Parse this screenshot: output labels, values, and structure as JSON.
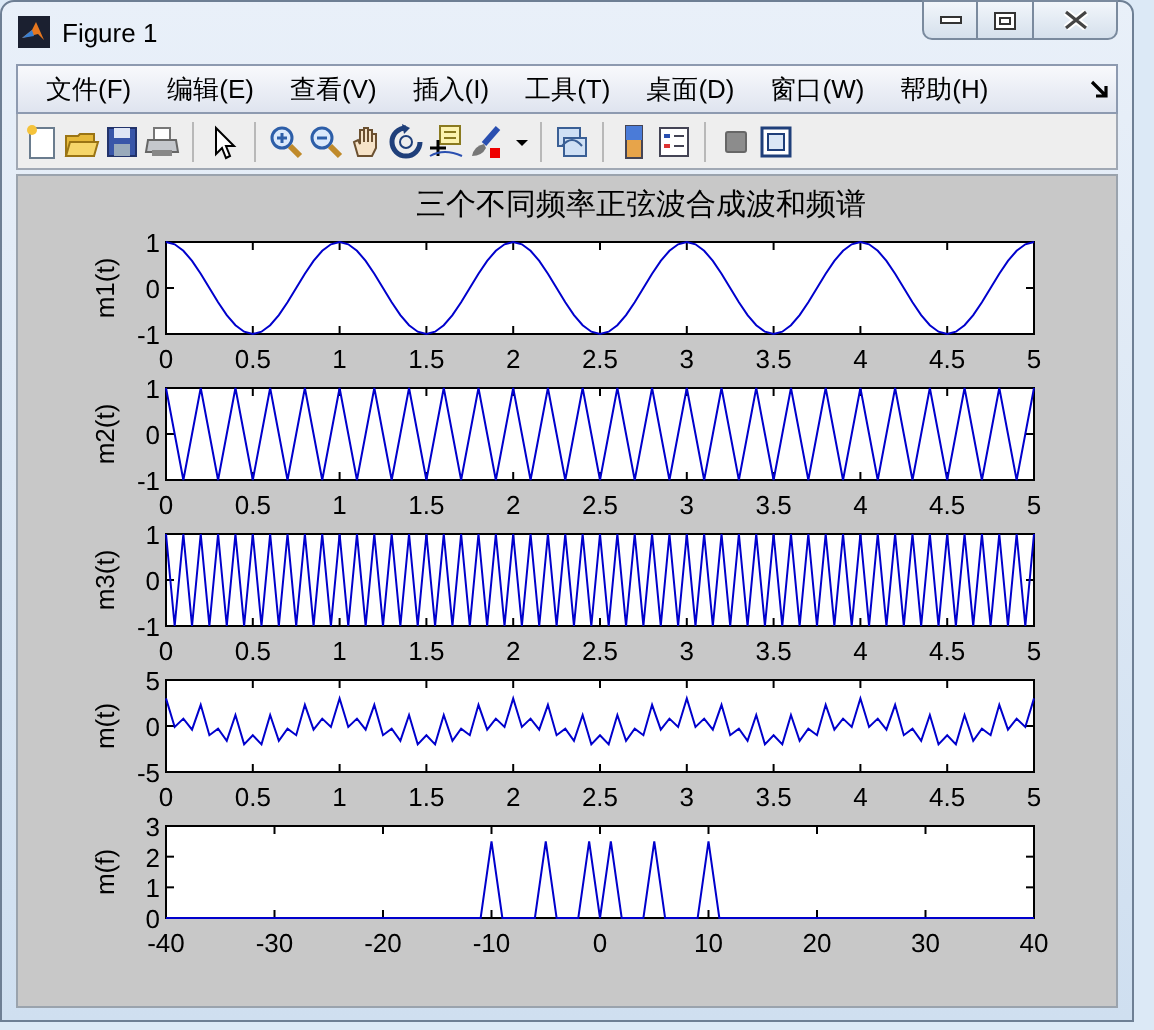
{
  "window": {
    "title": "Figure 1"
  },
  "menu": [
    "文件(F)",
    "编辑(E)",
    "查看(V)",
    "插入(I)",
    "工具(T)",
    "桌面(D)",
    "窗口(W)",
    "帮助(H)"
  ],
  "figure": {
    "title": "三个不同频率正弦波合成波和频谱",
    "axes": [
      {
        "chart_data": {
          "type": "line",
          "ylabel": "m1(t)",
          "xlim": [
            0,
            5
          ],
          "ylim": [
            -1,
            1
          ],
          "xticks": [
            0,
            0.5,
            1,
            1.5,
            2,
            2.5,
            3,
            3.5,
            4,
            4.5,
            5
          ],
          "yticks": [
            -1,
            0,
            1
          ],
          "x": [
            0,
            0.05,
            0.1,
            0.15,
            0.2,
            0.25,
            0.3,
            0.35,
            0.4,
            0.45,
            0.5,
            0.55,
            0.6,
            0.65,
            0.7,
            0.75,
            0.8,
            0.85,
            0.9,
            0.95,
            1,
            1.05,
            1.1,
            1.15,
            1.2,
            1.25,
            1.3,
            1.35,
            1.4,
            1.45,
            1.5,
            1.55,
            1.6,
            1.65,
            1.7,
            1.75,
            1.8,
            1.85,
            1.9,
            1.95,
            2,
            2.05,
            2.1,
            2.15,
            2.2,
            2.25,
            2.3,
            2.35,
            2.4,
            2.45,
            2.5,
            2.55,
            2.6,
            2.65,
            2.7,
            2.75,
            2.8,
            2.85,
            2.9,
            2.95,
            3,
            3.05,
            3.1,
            3.15,
            3.2,
            3.25,
            3.3,
            3.35,
            3.4,
            3.45,
            3.5,
            3.55,
            3.6,
            3.65,
            3.7,
            3.75,
            3.8,
            3.85,
            3.9,
            3.95,
            4,
            4.05,
            4.1,
            4.15,
            4.2,
            4.25,
            4.3,
            4.35,
            4.4,
            4.45,
            4.5,
            4.55,
            4.6,
            4.65,
            4.7,
            4.75,
            4.8,
            4.85,
            4.9,
            4.95,
            5
          ],
          "series": [
            {
              "color": "#0000cc",
              "values": [
                1,
                0.95,
                0.81,
                0.59,
                0.31,
                0,
                -0.31,
                -0.59,
                -0.81,
                -0.95,
                -1,
                -0.95,
                -0.81,
                -0.59,
                -0.31,
                0,
                0.31,
                0.59,
                0.81,
                0.95,
                1,
                0.95,
                0.81,
                0.59,
                0.31,
                0,
                -0.31,
                -0.59,
                -0.81,
                -0.95,
                -1,
                -0.95,
                -0.81,
                -0.59,
                -0.31,
                0,
                0.31,
                0.59,
                0.81,
                0.95,
                1,
                0.95,
                0.81,
                0.59,
                0.31,
                0,
                -0.31,
                -0.59,
                -0.81,
                -0.95,
                -1,
                -0.95,
                -0.81,
                -0.59,
                -0.31,
                0,
                0.31,
                0.59,
                0.81,
                0.95,
                1,
                0.95,
                0.81,
                0.59,
                0.31,
                0,
                -0.31,
                -0.59,
                -0.81,
                -0.95,
                -1,
                -0.95,
                -0.81,
                -0.59,
                -0.31,
                0,
                0.31,
                0.59,
                0.81,
                0.95,
                1,
                0.95,
                0.81,
                0.59,
                0.31,
                0,
                -0.31,
                -0.59,
                -0.81,
                -0.95,
                -1,
                -0.95,
                -0.81,
                -0.59,
                -0.31,
                0,
                0.31,
                0.59,
                0.81,
                0.95,
                1
              ]
            }
          ]
        }
      },
      {
        "chart_data": {
          "type": "line",
          "ylabel": "m2(t)",
          "xlim": [
            0,
            5
          ],
          "ylim": [
            -1,
            1
          ],
          "xticks": [
            0,
            0.5,
            1,
            1.5,
            2,
            2.5,
            3,
            3.5,
            4,
            4.5,
            5
          ],
          "yticks": [
            -1,
            0,
            1
          ],
          "x": [
            0,
            0.05,
            0.1,
            0.15,
            0.2,
            0.25,
            0.3,
            0.35,
            0.4,
            0.45,
            0.5,
            0.55,
            0.6,
            0.65,
            0.7,
            0.75,
            0.8,
            0.85,
            0.9,
            0.95,
            1,
            1.05,
            1.1,
            1.15,
            1.2,
            1.25,
            1.3,
            1.35,
            1.4,
            1.45,
            1.5,
            1.55,
            1.6,
            1.65,
            1.7,
            1.75,
            1.8,
            1.85,
            1.9,
            1.95,
            2,
            2.05,
            2.1,
            2.15,
            2.2,
            2.25,
            2.3,
            2.35,
            2.4,
            2.45,
            2.5,
            2.55,
            2.6,
            2.65,
            2.7,
            2.75,
            2.8,
            2.85,
            2.9,
            2.95,
            3,
            3.05,
            3.1,
            3.15,
            3.2,
            3.25,
            3.3,
            3.35,
            3.4,
            3.45,
            3.5,
            3.55,
            3.6,
            3.65,
            3.7,
            3.75,
            3.8,
            3.85,
            3.9,
            3.95,
            4,
            4.05,
            4.1,
            4.15,
            4.2,
            4.25,
            4.3,
            4.35,
            4.4,
            4.45,
            4.5,
            4.55,
            4.6,
            4.65,
            4.7,
            4.75,
            4.8,
            4.85,
            4.9,
            4.95,
            5
          ],
          "series": [
            {
              "color": "#0000cc",
              "values": [
                1,
                0,
                -1,
                0,
                1,
                0,
                -1,
                0,
                1,
                0,
                -1,
                0,
                1,
                0,
                -1,
                0,
                1,
                0,
                -1,
                0,
                1,
                0,
                -1,
                0,
                1,
                0,
                -1,
                0,
                1,
                0,
                -1,
                0,
                1,
                0,
                -1,
                0,
                1,
                0,
                -1,
                0,
                1,
                0,
                -1,
                0,
                1,
                0,
                -1,
                0,
                1,
                0,
                -1,
                0,
                1,
                0,
                -1,
                0,
                1,
                0,
                -1,
                0,
                1,
                0,
                -1,
                0,
                1,
                0,
                -1,
                0,
                1,
                0,
                -1,
                0,
                1,
                0,
                -1,
                0,
                1,
                0,
                -1,
                0,
                1,
                0,
                -1,
                0,
                1,
                0,
                -1,
                0,
                1,
                0,
                -1,
                0,
                1,
                0,
                -1,
                0,
                1,
                0,
                -1,
                0,
                1
              ]
            }
          ]
        }
      },
      {
        "chart_data": {
          "type": "line",
          "ylabel": "m3(t)",
          "xlim": [
            0,
            5
          ],
          "ylim": [
            -1,
            1
          ],
          "xticks": [
            0,
            0.5,
            1,
            1.5,
            2,
            2.5,
            3,
            3.5,
            4,
            4.5,
            5
          ],
          "yticks": [
            -1,
            0,
            1
          ],
          "x": [
            0,
            0.05,
            0.1,
            0.15,
            0.2,
            0.25,
            0.3,
            0.35,
            0.4,
            0.45,
            0.5,
            0.55,
            0.6,
            0.65,
            0.7,
            0.75,
            0.8,
            0.85,
            0.9,
            0.95,
            1,
            1.05,
            1.1,
            1.15,
            1.2,
            1.25,
            1.3,
            1.35,
            1.4,
            1.45,
            1.5,
            1.55,
            1.6,
            1.65,
            1.7,
            1.75,
            1.8,
            1.85,
            1.9,
            1.95,
            2,
            2.05,
            2.1,
            2.15,
            2.2,
            2.25,
            2.3,
            2.35,
            2.4,
            2.45,
            2.5,
            2.55,
            2.6,
            2.65,
            2.7,
            2.75,
            2.8,
            2.85,
            2.9,
            2.95,
            3,
            3.05,
            3.1,
            3.15,
            3.2,
            3.25,
            3.3,
            3.35,
            3.4,
            3.45,
            3.5,
            3.55,
            3.6,
            3.65,
            3.7,
            3.75,
            3.8,
            3.85,
            3.9,
            3.95,
            4,
            4.05,
            4.1,
            4.15,
            4.2,
            4.25,
            4.3,
            4.35,
            4.4,
            4.45,
            4.5,
            4.55,
            4.6,
            4.65,
            4.7,
            4.75,
            4.8,
            4.85,
            4.9,
            4.95,
            5
          ],
          "series": [
            {
              "color": "#0000cc",
              "values": [
                1,
                -1,
                1,
                -1,
                1,
                -1,
                1,
                -1,
                1,
                -1,
                1,
                -1,
                1,
                -1,
                1,
                -1,
                1,
                -1,
                1,
                -1,
                1,
                -1,
                1,
                -1,
                1,
                -1,
                1,
                -1,
                1,
                -1,
                1,
                -1,
                1,
                -1,
                1,
                -1,
                1,
                -1,
                1,
                -1,
                1,
                -1,
                1,
                -1,
                1,
                -1,
                1,
                -1,
                1,
                -1,
                1,
                -1,
                1,
                -1,
                1,
                -1,
                1,
                -1,
                1,
                -1,
                1,
                -1,
                1,
                -1,
                1,
                -1,
                1,
                -1,
                1,
                -1,
                1,
                -1,
                1,
                -1,
                1,
                -1,
                1,
                -1,
                1,
                -1,
                1,
                -1,
                1,
                -1,
                1,
                -1,
                1,
                -1,
                1,
                -1,
                1,
                -1,
                1,
                -1,
                1,
                -1,
                1,
                -1,
                1,
                -1,
                1
              ]
            }
          ]
        }
      },
      {
        "chart_data": {
          "type": "line",
          "ylabel": "m(t)",
          "xlim": [
            0,
            5
          ],
          "ylim": [
            -5,
            5
          ],
          "xticks": [
            0,
            0.5,
            1,
            1.5,
            2,
            2.5,
            3,
            3.5,
            4,
            4.5,
            5
          ],
          "yticks": [
            -5,
            0,
            5
          ],
          "x": [
            0,
            0.05,
            0.1,
            0.15,
            0.2,
            0.25,
            0.3,
            0.35,
            0.4,
            0.45,
            0.5,
            0.55,
            0.6,
            0.65,
            0.7,
            0.75,
            0.8,
            0.85,
            0.9,
            0.95,
            1,
            1.05,
            1.1,
            1.15,
            1.2,
            1.25,
            1.3,
            1.35,
            1.4,
            1.45,
            1.5,
            1.55,
            1.6,
            1.65,
            1.7,
            1.75,
            1.8,
            1.85,
            1.9,
            1.95,
            2,
            2.05,
            2.1,
            2.15,
            2.2,
            2.25,
            2.3,
            2.35,
            2.4,
            2.45,
            2.5,
            2.55,
            2.6,
            2.65,
            2.7,
            2.75,
            2.8,
            2.85,
            2.9,
            2.95,
            3,
            3.05,
            3.1,
            3.15,
            3.2,
            3.25,
            3.3,
            3.35,
            3.4,
            3.45,
            3.5,
            3.55,
            3.6,
            3.65,
            3.7,
            3.75,
            3.8,
            3.85,
            3.9,
            3.95,
            4,
            4.05,
            4.1,
            4.15,
            4.2,
            4.25,
            4.3,
            4.35,
            4.4,
            4.45,
            4.5,
            4.55,
            4.6,
            4.65,
            4.7,
            4.75,
            4.8,
            4.85,
            4.9,
            4.95,
            5
          ],
          "series": [
            {
              "color": "#0000cc",
              "values": [
                3,
                -0.1,
                0.8,
                -0.4,
                2.3,
                -1,
                -0.3,
                -1.6,
                1.2,
                -2,
                -1,
                -2,
                1.2,
                -1.6,
                -0.3,
                -1,
                2.3,
                -0.4,
                0.8,
                -0.1,
                3,
                -0.1,
                0.8,
                -0.4,
                2.3,
                -1,
                -0.3,
                -1.6,
                1.2,
                -2,
                -1,
                -2,
                1.2,
                -1.6,
                -0.3,
                -1,
                2.3,
                -0.4,
                0.8,
                -0.1,
                3,
                -0.1,
                0.8,
                -0.4,
                2.3,
                -1,
                -0.3,
                -1.6,
                1.2,
                -2,
                -1,
                -2,
                1.2,
                -1.6,
                -0.3,
                -1,
                2.3,
                -0.4,
                0.8,
                -0.1,
                3,
                -0.1,
                0.8,
                -0.4,
                2.3,
                -1,
                -0.3,
                -1.6,
                1.2,
                -2,
                -1,
                -2,
                1.2,
                -1.6,
                -0.3,
                -1,
                2.3,
                -0.4,
                0.8,
                -0.1,
                3,
                -0.1,
                0.8,
                -0.4,
                2.3,
                -1,
                -0.3,
                -1.6,
                1.2,
                -2,
                -1,
                -2,
                1.2,
                -1.6,
                -0.3,
                -1,
                2.3,
                -0.4,
                0.8,
                -0.1,
                3
              ]
            }
          ]
        }
      },
      {
        "chart_data": {
          "type": "line",
          "ylabel": "m(f)",
          "xlim": [
            -40,
            40
          ],
          "ylim": [
            0,
            3
          ],
          "xticks": [
            -40,
            -30,
            -20,
            -10,
            0,
            10,
            20,
            30,
            40
          ],
          "yticks": [
            0,
            1,
            2,
            3
          ],
          "x": [
            -40,
            -39,
            -38,
            -37,
            -36,
            -35,
            -34,
            -33,
            -32,
            -31,
            -30,
            -29,
            -28,
            -27,
            -26,
            -25,
            -24,
            -23,
            -22,
            -21,
            -20,
            -19,
            -18,
            -17,
            -16,
            -15,
            -14,
            -13,
            -12,
            -11,
            -10,
            -9,
            -8,
            -7,
            -6,
            -5,
            -4,
            -3,
            -2,
            -1,
            0,
            1,
            2,
            3,
            4,
            5,
            6,
            7,
            8,
            9,
            10,
            11,
            12,
            13,
            14,
            15,
            16,
            17,
            18,
            19,
            20,
            21,
            22,
            23,
            24,
            25,
            26,
            27,
            28,
            29,
            30,
            31,
            32,
            33,
            34,
            35,
            36,
            37,
            38,
            39,
            40
          ],
          "series": [
            {
              "color": "#0000cc",
              "values": [
                0,
                0,
                0,
                0,
                0,
                0,
                0,
                0,
                0,
                0,
                0,
                0,
                0,
                0,
                0,
                0,
                0,
                0,
                0,
                0,
                0,
                0,
                0,
                0,
                0,
                0,
                0,
                0,
                0,
                0,
                2.5,
                0,
                0,
                0,
                0,
                2.5,
                0,
                0,
                0,
                2.5,
                0,
                2.5,
                0,
                0,
                0,
                2.5,
                0,
                0,
                0,
                0,
                2.5,
                0,
                0,
                0,
                0,
                0,
                0,
                0,
                0,
                0,
                0,
                0,
                0,
                0,
                0,
                0,
                0,
                0,
                0,
                0,
                0,
                0,
                0,
                0,
                0,
                0,
                0,
                0,
                0,
                0,
                0
              ]
            }
          ]
        }
      }
    ]
  }
}
